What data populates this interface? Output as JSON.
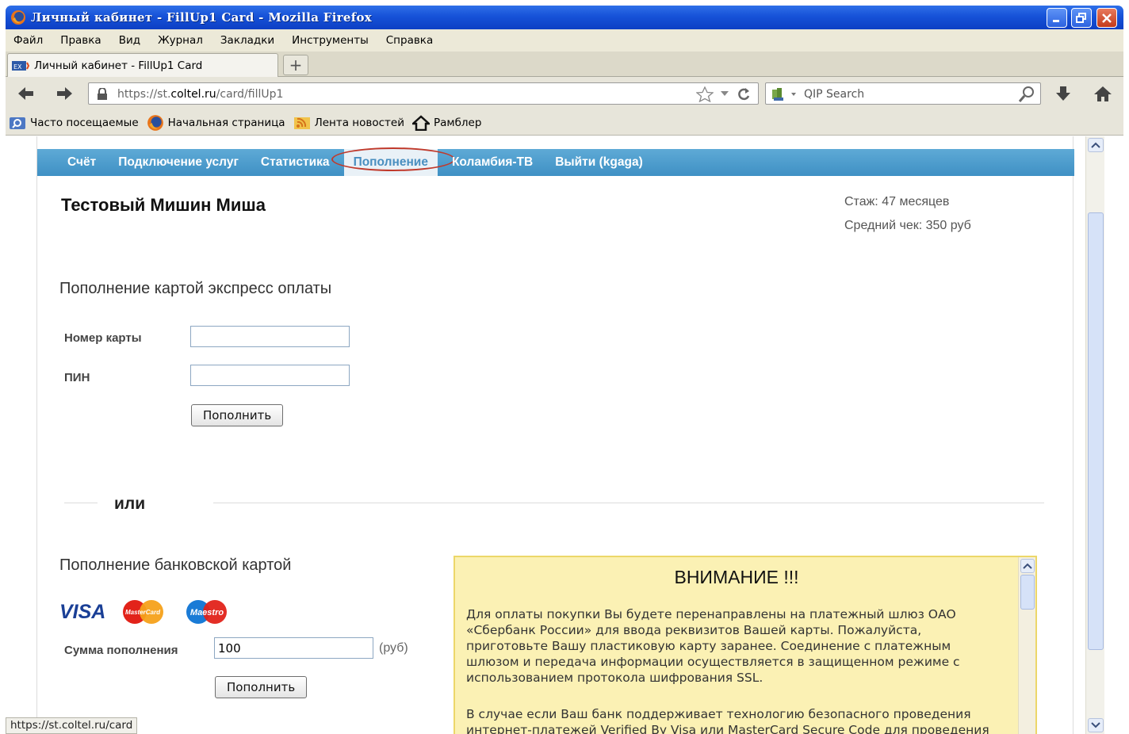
{
  "window": {
    "title": "Личный кабинет - FillUp1 Card - Mozilla Firefox"
  },
  "menubar": [
    "Файл",
    "Правка",
    "Вид",
    "Журнал",
    "Закладки",
    "Инструменты",
    "Справка"
  ],
  "tab": {
    "label": "Личный кабинет - FillUp1 Card",
    "new_tab": "+"
  },
  "navbar": {
    "url_prefix": "https://st.",
    "url_domain": "coltel.ru",
    "url_path": "/card/fillUp1",
    "search_placeholder": "QIP Search"
  },
  "bookmarks": [
    "Часто посещаемые",
    "Начальная страница",
    "Лента новостей",
    "Рамблер"
  ],
  "site_nav": [
    {
      "label": "Счёт"
    },
    {
      "label": "Подключение услуг"
    },
    {
      "label": "Статистика"
    },
    {
      "label": "Пополнение",
      "active": true
    },
    {
      "label": "Коламбия-ТВ"
    },
    {
      "label": "Выйти (kgaga)"
    }
  ],
  "user": {
    "name": "Тестовый Мишин Миша",
    "tenure": "Стаж: 47 месяцев",
    "avg_check": "Средний чек: 350 руб"
  },
  "express": {
    "title": "Пополнение картой экспресс оплаты",
    "card_label": "Номер карты",
    "card_value": "",
    "pin_label": "ПИН",
    "pin_value": "",
    "button": "Пополнить"
  },
  "or_text": "или",
  "bank": {
    "title": "Пополнение банковской картой",
    "logos": {
      "visa": "VISA",
      "mastercard": "MasterCard",
      "maestro": "Maestro"
    },
    "amount_label": "Сумма пополнения",
    "amount_value": "100",
    "unit": "(руб)",
    "button": "Пополнить"
  },
  "notice": {
    "title": "ВНИМАНИЕ !!!",
    "p1": "Для оплаты покупки Вы будете перенаправлены на платежный шлюз ОАО «Сбербанк России» для ввода реквизитов Вашей карты. Пожалуйста, приготовьте Вашу пластиковую карту заранее. Соединение с платежным шлюзом и передача информации осуществляется в защищенном режиме с использованием протокола шифрования SSL.",
    "p2": "В случае если Ваш банк поддерживает технологию безопасного проведения интернет-платежей Verified By Visa или MasterCard Secure Code для проведения"
  },
  "status_bar": "https://st.coltel.ru/card",
  "colors": {
    "nav_bar": "#4a9bcc",
    "notice_bg": "#fbf1b4",
    "highlight_circle": "#c0392b"
  }
}
